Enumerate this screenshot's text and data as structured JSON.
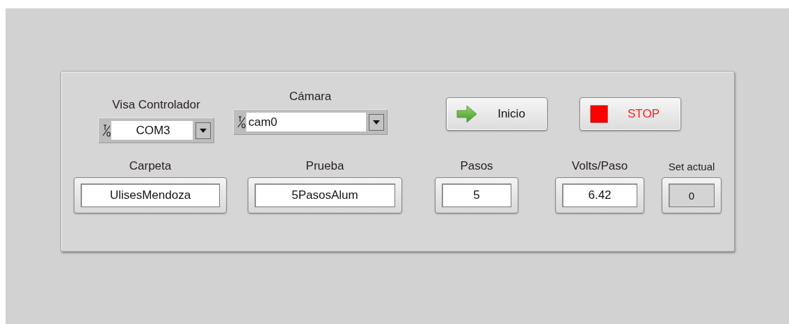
{
  "selectors": [
    {
      "label": "Visa Controlador",
      "value": "COM3"
    },
    {
      "label": "Cámara",
      "value": "cam0"
    }
  ],
  "buttons": [
    {
      "kind": "start",
      "label": "Inicio"
    },
    {
      "kind": "stop",
      "label": "STOP"
    }
  ],
  "fields": [
    {
      "kind": "control",
      "label": "Carpeta",
      "value": "UlisesMendoza"
    },
    {
      "kind": "control",
      "label": "Prueba",
      "value": "5PasosAlum"
    },
    {
      "kind": "control",
      "label": "Pasos",
      "value": "5"
    },
    {
      "kind": "control",
      "label": "Volts/Paso",
      "value": "6.42"
    },
    {
      "kind": "indicator",
      "label": "Set actual",
      "value": "0"
    }
  ]
}
